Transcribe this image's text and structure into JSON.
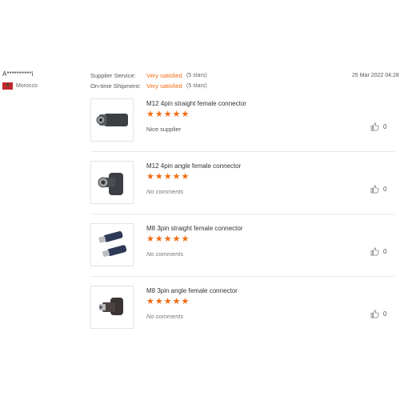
{
  "reviewer": {
    "name": "A**********i",
    "country": "Morocco",
    "flag_icon": "morocco-flag-icon"
  },
  "ratings": [
    {
      "label": "Supplier Service:",
      "value": "Very satisfied",
      "stars": "(5 stars)"
    },
    {
      "label": "On-time Shipment:",
      "value": "Very satisfied",
      "stars": "(5 stars)"
    }
  ],
  "date": "25 Mar 2022 04:28",
  "reviews": [
    {
      "product": "M12 4pin straight female connector",
      "rating": 5,
      "comment": "Nice supplier",
      "likes": "0",
      "thumb_icon": "m12-straight-connector-icon"
    },
    {
      "product": "M12 4pin angle female connector",
      "rating": 5,
      "comment": "No comments",
      "likes": "0",
      "thumb_icon": "m12-angle-connector-icon"
    },
    {
      "product": "M8 3pin straight female connector",
      "rating": 5,
      "comment": "No comments",
      "likes": "0",
      "thumb_icon": "m8-straight-connector-icon"
    },
    {
      "product": "M8 3pin angle female connector",
      "rating": 5,
      "comment": "No comments",
      "likes": "0",
      "thumb_icon": "m8-angle-connector-icon"
    }
  ],
  "colors": {
    "accent": "#f26a0f",
    "divider": "#e8e8e8"
  }
}
